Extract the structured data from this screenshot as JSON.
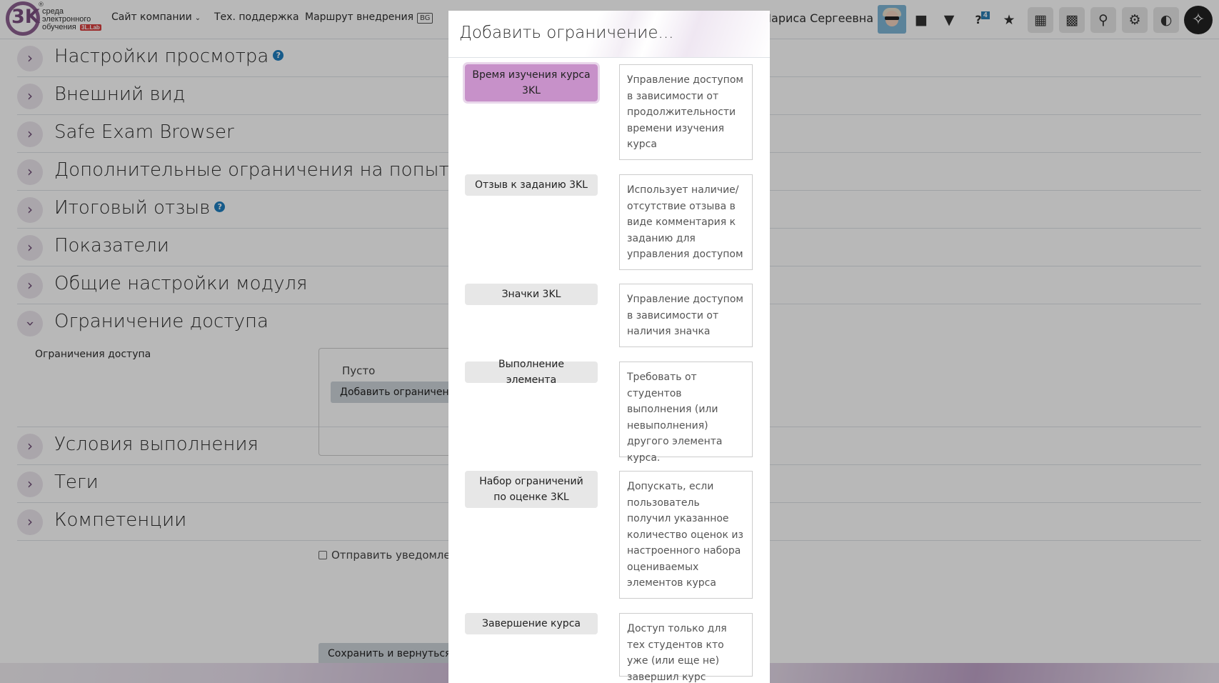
{
  "header": {
    "logo_reg": "®",
    "logo_line1": "среда",
    "logo_line2": "электронного",
    "logo_line3": "обучения",
    "logo_badge": "3L.Lab",
    "nav": [
      {
        "label": "Сайт компании",
        "chevron": "⌄"
      },
      {
        "label": "Тех. поддержка"
      },
      {
        "label": "Маршрут внедрения"
      }
    ],
    "lang": "BG",
    "user_name": "Лариса Сергеевна",
    "question_badge": "4",
    "icons": [
      "chat-icon",
      "bell-icon",
      "question-icon",
      "trophy-icon",
      "grid-icon",
      "puzzle-icon",
      "search-icon",
      "gear-icon",
      "toggle-icon",
      "accessibility-icon"
    ]
  },
  "sections": [
    {
      "title": "Настройки просмотра",
      "help": true
    },
    {
      "title": "Внешний вид"
    },
    {
      "title": "Safe Exam Browser"
    },
    {
      "title": "Дополнительные ограничения на попытки"
    },
    {
      "title": "Итоговый отзыв",
      "help": true
    },
    {
      "title": "Показатели"
    },
    {
      "title": "Общие настройки модуля"
    },
    {
      "title": "Ограничение доступа",
      "expanded": true
    },
    {
      "title": "Условия выполнения"
    },
    {
      "title": "Теги"
    },
    {
      "title": "Компетенции"
    }
  ],
  "restrictions": {
    "label": "Ограничения доступа",
    "empty": "Пусто",
    "add_button": "Добавить ограничение..."
  },
  "notify_label": "Отправить уведомление",
  "save_button": "Сохранить и вернуться к курсу",
  "modal": {
    "title": "Добавить ограничение...",
    "options": [
      {
        "label": "Время изучения курса 3KL",
        "description": "Управление доступом в зависимости от продолжительности времени изучения курса",
        "active": true
      },
      {
        "label": "Отзыв к заданию 3KL",
        "description": "Использует наличие/отсутствие отзыва в виде комментария к заданию для управления доступом"
      },
      {
        "label": "Значки 3KL",
        "description": "Управление доступом в зависимости от наличия значка"
      },
      {
        "label": "Выполнение элемента",
        "description": "Требовать от студентов выполнения (или невыполнения) другого элемента курса."
      },
      {
        "label": "Набор ограничений по оценке 3KL",
        "description": "Допускать, если пользователь получил указанное количество оценок из настроенного набора оцениваемых элементов курса"
      },
      {
        "label": "Завершение курса",
        "description": "Доступ только для тех студентов кто уже (или еще не) завершил курс"
      }
    ]
  },
  "colors": {
    "accent": "#6b4a72",
    "active_option": "#c791c9",
    "help": "#1f7fbf"
  }
}
